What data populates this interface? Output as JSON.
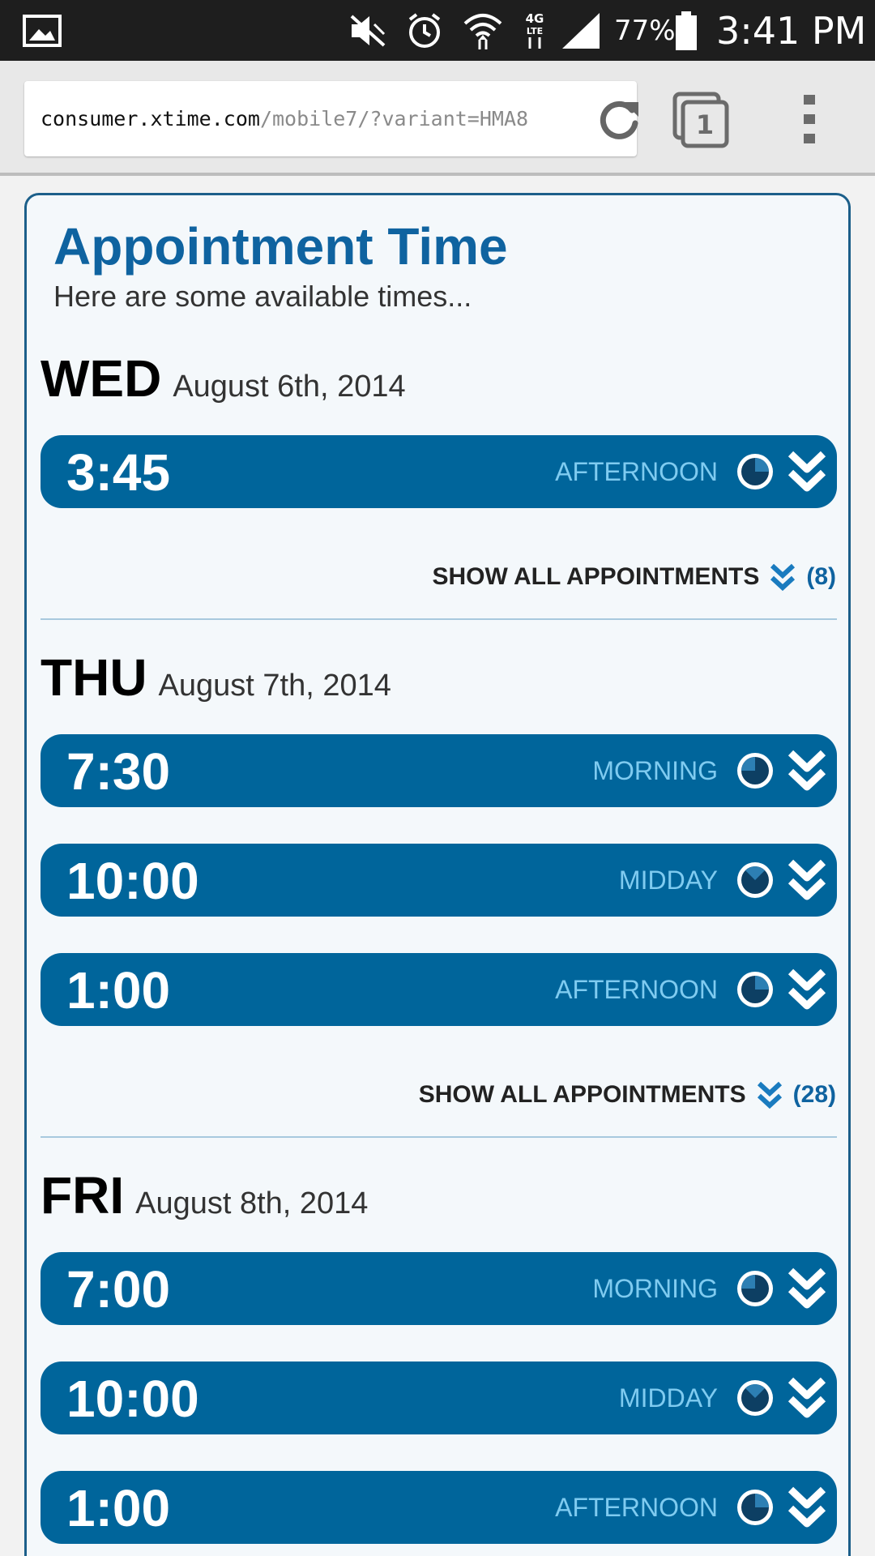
{
  "status_bar": {
    "battery": "77%",
    "time": "3:41 PM",
    "icons": [
      "gallery-icon",
      "mute-icon",
      "alarm-icon",
      "wifi-icon",
      "lte-icon",
      "signal-icon",
      "battery-icon"
    ],
    "network_label": "4G LTE"
  },
  "browser": {
    "url_host": "consumer.xtime.com",
    "url_path": "/mobile7/?variant=HMA8",
    "tab_count": "1"
  },
  "page": {
    "title": "Appointment Time",
    "subtitle": "Here are some available times..."
  },
  "days": [
    {
      "day": "WED",
      "date": "August 6th, 2014",
      "slots": [
        {
          "time": "3:45",
          "period": "AFTERNOON"
        }
      ],
      "show_all_label": "SHOW ALL APPOINTMENTS",
      "show_all_count": "(8)"
    },
    {
      "day": "THU",
      "date": "August 7th, 2014",
      "slots": [
        {
          "time": "7:30",
          "period": "MORNING"
        },
        {
          "time": "10:00",
          "period": "MIDDAY"
        },
        {
          "time": "1:00",
          "period": "AFTERNOON"
        }
      ],
      "show_all_label": "SHOW ALL APPOINTMENTS",
      "show_all_count": "(28)"
    },
    {
      "day": "FRI",
      "date": "August 8th, 2014",
      "slots": [
        {
          "time": "7:00",
          "period": "MORNING"
        },
        {
          "time": "10:00",
          "period": "MIDDAY"
        },
        {
          "time": "1:00",
          "period": "AFTERNOON"
        }
      ]
    }
  ],
  "colors": {
    "brand_blue": "#00659b",
    "title_blue": "#0f63a0",
    "period_text": "#7fcbf0"
  }
}
